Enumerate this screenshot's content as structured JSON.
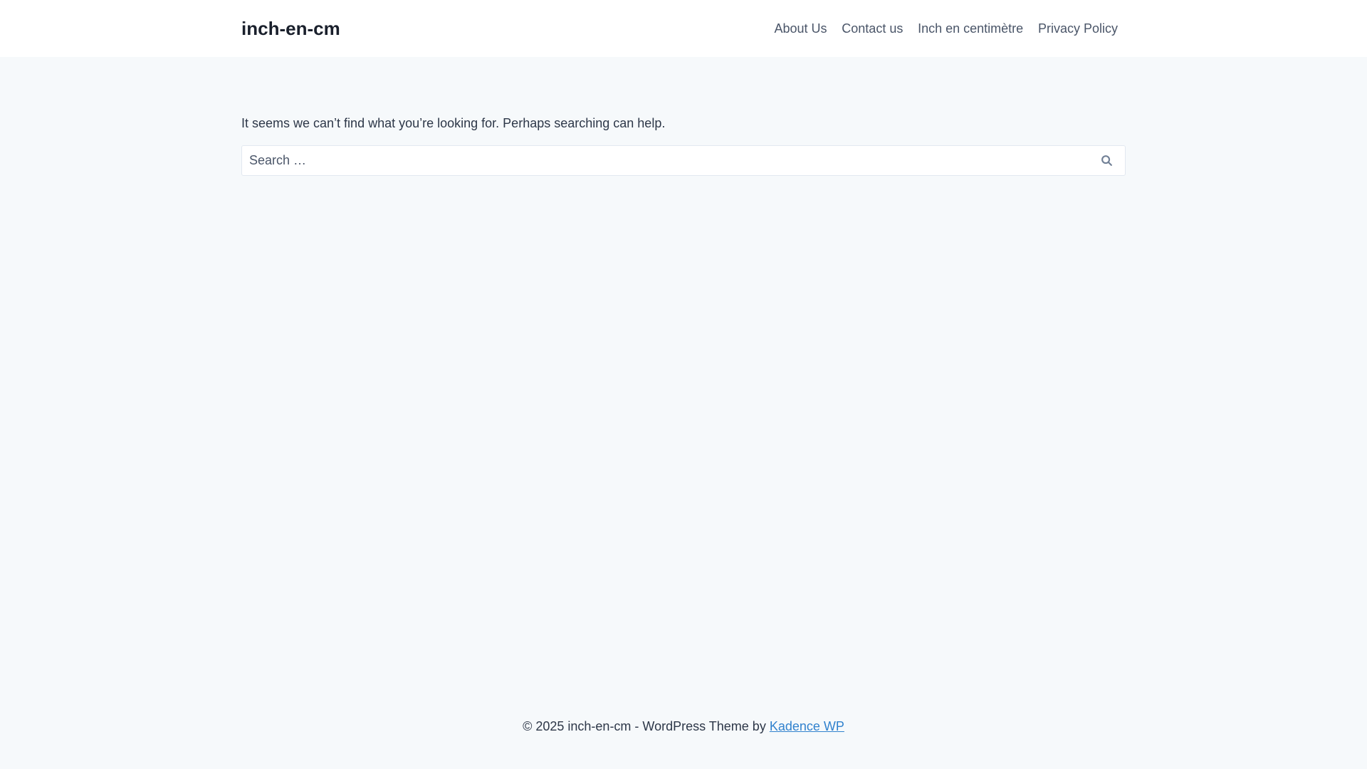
{
  "header": {
    "site_title": "inch-en-cm",
    "nav": [
      {
        "label": "About Us"
      },
      {
        "label": "Contact us"
      },
      {
        "label": "Inch en centimètre"
      },
      {
        "label": "Privacy Policy"
      }
    ]
  },
  "main": {
    "message": "It seems we can’t find what you’re looking for. Perhaps searching can help.",
    "search": {
      "placeholder": "Search …",
      "value": "",
      "icon": "search-icon"
    }
  },
  "footer": {
    "text": "© 2025 inch-en-cm - WordPress Theme by ",
    "link_label": "Kadence WP"
  },
  "colors": {
    "page_background": "#f6f9fb",
    "header_background": "#ffffff",
    "title": "#1a202c",
    "nav_text": "#4a5568",
    "body_text": "#2d3748",
    "link": "#3182ce",
    "input_border": "#e2e8f0"
  }
}
